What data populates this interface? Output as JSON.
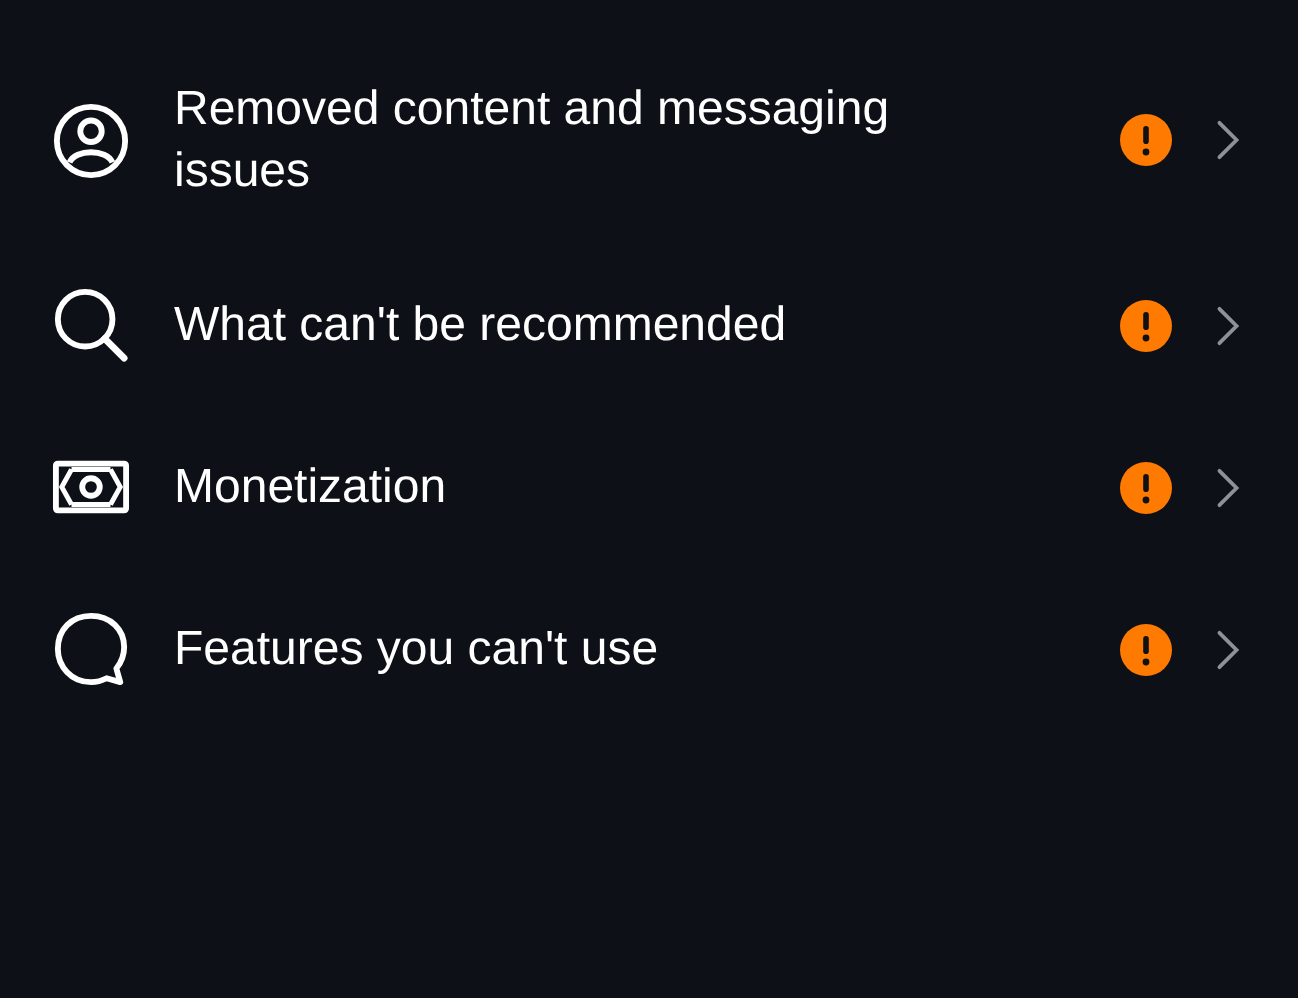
{
  "items": [
    {
      "label": "Removed content and messaging issues",
      "warning": true
    },
    {
      "label": "What can't be recommended",
      "warning": true
    },
    {
      "label": "Monetization",
      "warning": true
    },
    {
      "label": "Features you can't use",
      "warning": true
    }
  ]
}
